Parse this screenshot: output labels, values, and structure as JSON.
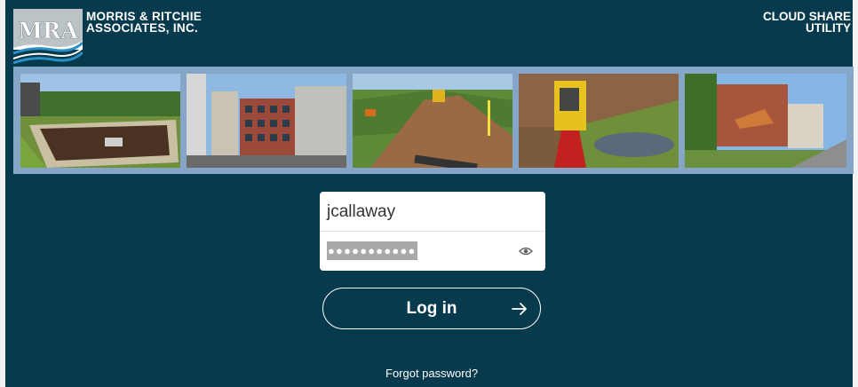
{
  "brand": {
    "logo_text": "MRA",
    "company_line1": "MORRIS & RITCHIE",
    "company_line2": "ASSOCIATES, INC.",
    "product_line1": "CLOUD SHARE",
    "product_line2": "UTILITY"
  },
  "colors": {
    "background": "#073a4d",
    "strip": "#86a6c7",
    "accent_blue": "#1c78a8"
  },
  "photos": [
    {
      "name": "stormwater-basin-photo"
    },
    {
      "name": "office-buildings-photo"
    },
    {
      "name": "construction-site-photo"
    },
    {
      "name": "survey-instrument-photo"
    },
    {
      "name": "residential-building-photo"
    }
  ],
  "login": {
    "username_value": "jcallaway",
    "password_mask": "●●●●●●●●●●●",
    "show_password_icon": "eye-icon",
    "button_label": "Log in",
    "button_icon": "arrow-right-icon",
    "forgot_link": "Forgot password?"
  }
}
